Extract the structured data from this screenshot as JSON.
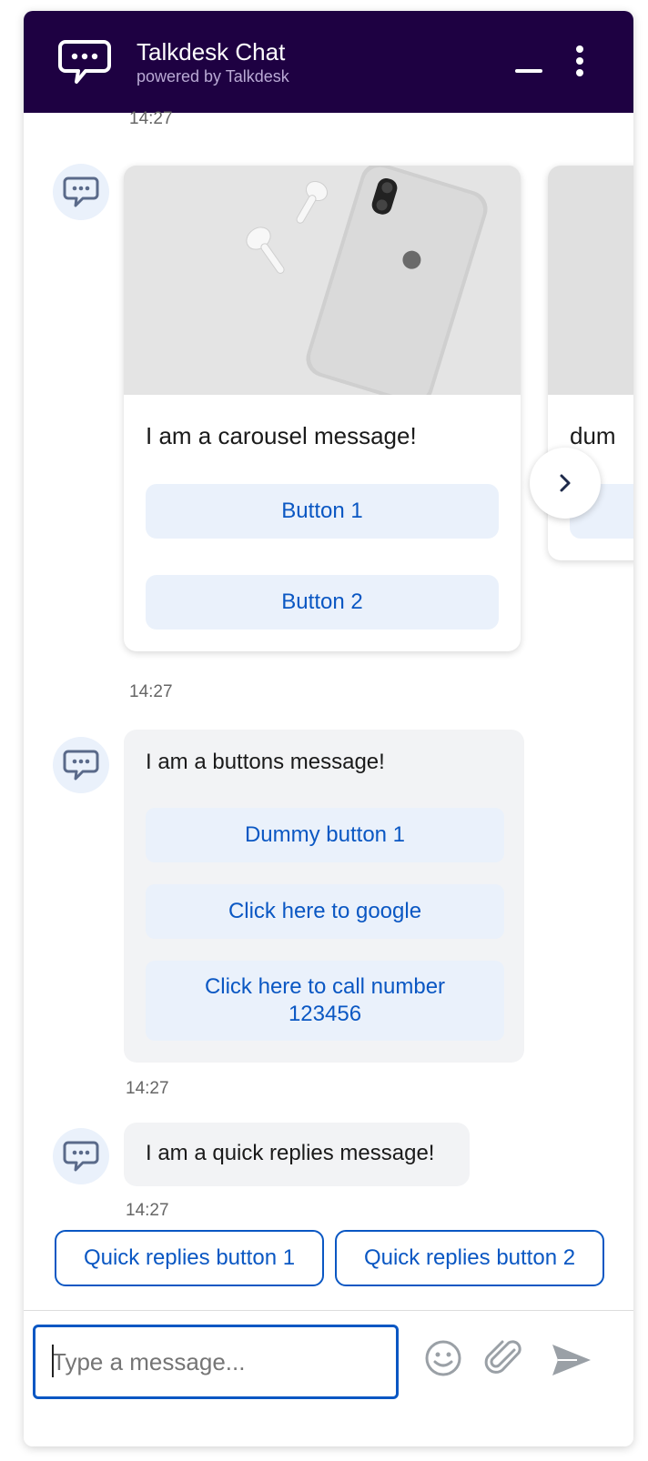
{
  "header": {
    "title": "Talkdesk Chat",
    "subtitle": "powered by Talkdesk"
  },
  "messages": {
    "top_timestamp": "14:27",
    "carousel": {
      "cards": [
        {
          "text": "I am a carousel message!",
          "buttons": [
            "Button 1",
            "Button 2"
          ]
        },
        {
          "text": "dum"
        }
      ],
      "timestamp": "14:27"
    },
    "buttons_message": {
      "text": "I am a buttons message!",
      "buttons": [
        "Dummy button 1",
        "Click here to google",
        "Click here to call number 123456"
      ],
      "timestamp": "14:27"
    },
    "quick_replies_message": {
      "text": "I am a quick replies message!",
      "timestamp": "14:27",
      "buttons": [
        "Quick replies button 1",
        "Quick replies button 2"
      ]
    }
  },
  "composer": {
    "placeholder": "Type a message..."
  },
  "colors": {
    "header_bg": "#1e0142",
    "accent": "#0a57c3",
    "button_bg": "#eaf1fb",
    "bubble_bg": "#f2f3f5"
  },
  "icons": [
    "chat-bubble-icon",
    "minimize-icon",
    "more-options-icon",
    "chevron-right-icon",
    "emoji-icon",
    "attachment-icon",
    "send-icon"
  ]
}
